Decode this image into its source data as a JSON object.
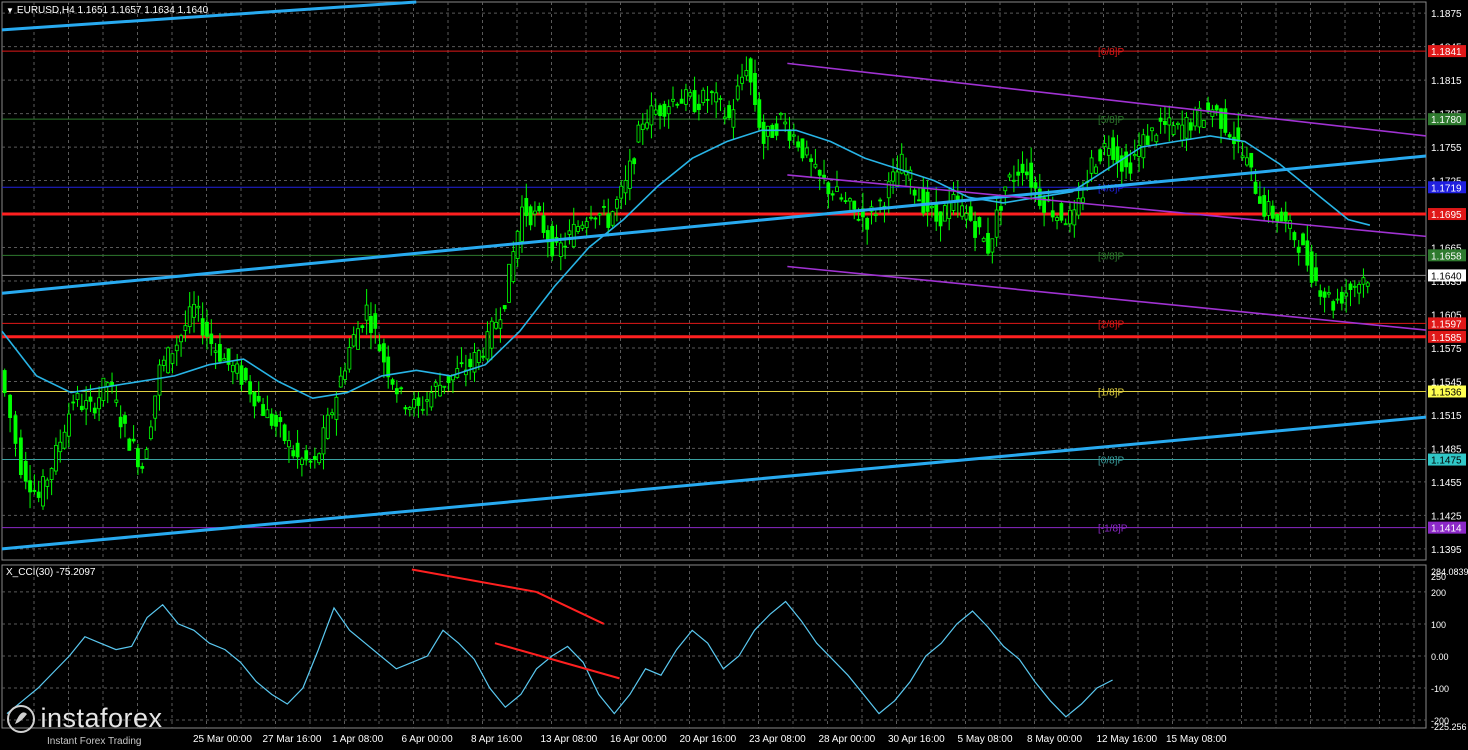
{
  "header": {
    "price_title": "EURUSD,H4  1.1651 1.1657 1.1634 1.1640",
    "cci_title": "X_CCI(30) -75.2097"
  },
  "brand": {
    "name": "instaforex",
    "tagline": "Instant Forex Trading"
  },
  "colors": {
    "background": "#000000",
    "grid": "#5a5a5a",
    "candle": "#00ff00",
    "ma": "#28b4e6",
    "trend": "#28aaf0",
    "channel": "#a032d2",
    "red_level": "#ff2020",
    "cci": "#5ac8f0"
  },
  "chart_data": [
    {
      "type": "candlestick",
      "symbol": "EURUSD",
      "timeframe": "H4",
      "ohlc_last": {
        "open": 1.1651,
        "high": 1.1657,
        "low": 1.1634,
        "close": 1.164
      },
      "ylim": [
        1.1385,
        1.1885
      ],
      "y_ticks": [
        "1.1875",
        "1.1845",
        "1.1815",
        "1.1785",
        "1.1755",
        "1.1725",
        "1.1695",
        "1.1665",
        "1.1635",
        "1.1605",
        "1.1575",
        "1.1545",
        "1.1515",
        "1.1485",
        "1.1455",
        "1.1425",
        "1.1395"
      ],
      "x_ticks": [
        "25 Mar 00:00",
        "27 Mar 16:00",
        "1 Apr 08:00",
        "6 Apr 00:00",
        "8 Apr 16:00",
        "13 Apr 08:00",
        "16 Apr 00:00",
        "20 Apr 16:00",
        "23 Apr 08:00",
        "28 Apr 00:00",
        "30 Apr 16:00",
        "5 May 08:00",
        "8 May 00:00",
        "12 May 16:00",
        "15 May 08:00"
      ],
      "close_path": [
        [
          0,
          1.1555
        ],
        [
          5,
          1.147
        ],
        [
          9,
          1.144
        ],
        [
          13,
          1.148
        ],
        [
          17,
          1.153
        ],
        [
          21,
          1.152
        ],
        [
          25,
          1.1545
        ],
        [
          29,
          1.15
        ],
        [
          33,
          1.147
        ],
        [
          37,
          1.1555
        ],
        [
          41,
          1.158
        ],
        [
          45,
          1.161
        ],
        [
          49,
          1.158
        ],
        [
          53,
          1.156
        ],
        [
          57,
          1.1545
        ],
        [
          61,
          1.152
        ],
        [
          65,
          1.15
        ],
        [
          69,
          1.1475
        ],
        [
          73,
          1.147
        ],
        [
          77,
          1.152
        ],
        [
          81,
          1.1575
        ],
        [
          85,
          1.161
        ],
        [
          89,
          1.1565
        ],
        [
          93,
          1.153
        ],
        [
          97,
          1.152
        ],
        [
          101,
          1.154
        ],
        [
          105,
          1.155
        ],
        [
          109,
          1.156
        ],
        [
          113,
          1.158
        ],
        [
          117,
          1.162
        ],
        [
          121,
          1.17
        ],
        [
          125,
          1.169
        ],
        [
          129,
          1.166
        ],
        [
          133,
          1.168
        ],
        [
          137,
          1.17
        ],
        [
          141,
          1.169
        ],
        [
          145,
          1.172
        ],
        [
          149,
          1.178
        ],
        [
          153,
          1.179
        ],
        [
          157,
          1.18
        ],
        [
          161,
          1.1795
        ],
        [
          165,
          1.18
        ],
        [
          169,
          1.178
        ],
        [
          173,
          1.183
        ],
        [
          177,
          1.176
        ],
        [
          181,
          1.178
        ],
        [
          185,
          1.176
        ],
        [
          189,
          1.173
        ],
        [
          193,
          1.1715
        ],
        [
          197,
          1.17
        ],
        [
          201,
          1.169
        ],
        [
          205,
          1.171
        ],
        [
          209,
          1.174
        ],
        [
          213,
          1.171
        ],
        [
          217,
          1.169
        ],
        [
          221,
          1.1705
        ],
        [
          225,
          1.169
        ],
        [
          229,
          1.1665
        ],
        [
          233,
          1.172
        ],
        [
          237,
          1.174
        ],
        [
          241,
          1.171
        ],
        [
          245,
          1.1695
        ],
        [
          249,
          1.169
        ],
        [
          253,
          1.174
        ],
        [
          257,
          1.176
        ],
        [
          261,
          1.1735
        ],
        [
          265,
          1.176
        ],
        [
          269,
          1.1775
        ],
        [
          273,
          1.177
        ],
        [
          277,
          1.178
        ],
        [
          281,
          1.179
        ],
        [
          285,
          1.177
        ],
        [
          289,
          1.174
        ],
        [
          293,
          1.17
        ],
        [
          297,
          1.169
        ],
        [
          301,
          1.167
        ],
        [
          305,
          1.1635
        ],
        [
          309,
          1.1615
        ],
        [
          313,
          1.163
        ],
        [
          317,
          1.164
        ]
      ],
      "ma_path": [
        [
          0,
          1.159
        ],
        [
          8,
          1.155
        ],
        [
          16,
          1.1535
        ],
        [
          24,
          1.154
        ],
        [
          32,
          1.1545
        ],
        [
          40,
          1.155
        ],
        [
          48,
          1.156
        ],
        [
          56,
          1.1565
        ],
        [
          64,
          1.1545
        ],
        [
          72,
          1.153
        ],
        [
          80,
          1.1535
        ],
        [
          88,
          1.155
        ],
        [
          96,
          1.1555
        ],
        [
          104,
          1.155
        ],
        [
          112,
          1.156
        ],
        [
          120,
          1.159
        ],
        [
          128,
          1.163
        ],
        [
          136,
          1.1665
        ],
        [
          144,
          1.169
        ],
        [
          152,
          1.172
        ],
        [
          160,
          1.1745
        ],
        [
          168,
          1.176
        ],
        [
          176,
          1.177
        ],
        [
          184,
          1.177
        ],
        [
          192,
          1.176
        ],
        [
          200,
          1.1745
        ],
        [
          208,
          1.1735
        ],
        [
          216,
          1.1725
        ],
        [
          224,
          1.171
        ],
        [
          232,
          1.1705
        ],
        [
          240,
          1.171
        ],
        [
          248,
          1.1715
        ],
        [
          256,
          1.1735
        ],
        [
          264,
          1.1755
        ],
        [
          272,
          1.176
        ],
        [
          280,
          1.1765
        ],
        [
          288,
          1.176
        ],
        [
          296,
          1.174
        ],
        [
          304,
          1.1715
        ],
        [
          312,
          1.169
        ],
        [
          317,
          1.1685
        ]
      ],
      "trend_lines": [
        {
          "from": [
            0,
            1.186
          ],
          "to": [
            96,
            1.1885
          ]
        },
        {
          "from": [
            0,
            1.1624
          ],
          "to": [
            330,
            1.1747
          ]
        },
        {
          "from": [
            0,
            1.1395
          ],
          "to": [
            330,
            1.1513
          ]
        }
      ],
      "channel_lines": [
        {
          "from": [
            182,
            1.183
          ],
          "to": [
            330,
            1.1765
          ]
        },
        {
          "from": [
            182,
            1.173
          ],
          "to": [
            330,
            1.1675
          ]
        },
        {
          "from": [
            182,
            1.1648
          ],
          "to": [
            330,
            1.1591
          ]
        }
      ],
      "levels": [
        {
          "price": 1.1841,
          "label": "[6/8]P",
          "value": "1.1841",
          "color": "#e01818",
          "bg": "#e01818",
          "style": "solid",
          "width": 1
        },
        {
          "price": 1.178,
          "label": "[5/8]P",
          "value": "1.1780",
          "color": "#2e7a2e",
          "bg": "#2e7a2e",
          "style": "solid",
          "width": 1
        },
        {
          "price": 1.1719,
          "label": "[4/8]P",
          "value": "1.1719",
          "color": "#2020e0",
          "bg": "#2020e0",
          "style": "solid",
          "width": 1
        },
        {
          "price": 1.1695,
          "label": "",
          "value": "1.1695",
          "color": "#ff2020",
          "bg": "#e01818",
          "style": "solid",
          "width": 3
        },
        {
          "price": 1.1658,
          "label": "[3/8]P",
          "value": "1.1658",
          "color": "#2e7a2e",
          "bg": "#2e7a2e",
          "style": "solid",
          "width": 1
        },
        {
          "price": 1.164,
          "label": "",
          "value": "1.1640",
          "color": "#8a8a8a",
          "bg": "#ffffff",
          "style": "solid",
          "width": 1
        },
        {
          "price": 1.1597,
          "label": "[2/8]P",
          "value": "1.1597",
          "color": "#e01818",
          "bg": "#e01818",
          "style": "solid",
          "width": 1
        },
        {
          "price": 1.1585,
          "label": "",
          "value": "1.1585",
          "color": "#ff2020",
          "bg": "#e01818",
          "style": "solid",
          "width": 3
        },
        {
          "price": 1.1536,
          "label": "[1/8]P",
          "value": "1.1536",
          "color": "#e0d040",
          "bg": "#ffff50",
          "style": "solid",
          "width": 1
        },
        {
          "price": 1.1475,
          "label": "[0/8]P",
          "value": "1.1475",
          "color": "#3aa0a0",
          "bg": "#30c8c8",
          "style": "solid",
          "width": 1
        },
        {
          "price": 1.1414,
          "label": "[-1/8]P",
          "value": "1.1414",
          "color": "#8c28c8",
          "bg": "#8c28c8",
          "style": "solid",
          "width": 1
        }
      ]
    },
    {
      "type": "line",
      "name": "X_CCI(30)",
      "value_last": -75.2097,
      "ylim": [
        -225,
        284.0839
      ],
      "y_ticks": [
        "284.0839",
        "250",
        "200",
        "100",
        "0.00",
        "-100",
        "-200",
        "-225.256"
      ],
      "series": [
        [
          0,
          -180
        ],
        [
          6,
          -140
        ],
        [
          12,
          -100
        ],
        [
          18,
          -50
        ],
        [
          24,
          0
        ],
        [
          30,
          60
        ],
        [
          36,
          40
        ],
        [
          42,
          20
        ],
        [
          48,
          30
        ],
        [
          54,
          120
        ],
        [
          60,
          160
        ],
        [
          66,
          100
        ],
        [
          72,
          80
        ],
        [
          78,
          40
        ],
        [
          84,
          20
        ],
        [
          90,
          -20
        ],
        [
          96,
          -80
        ],
        [
          102,
          -120
        ],
        [
          108,
          -150
        ],
        [
          114,
          -100
        ],
        [
          120,
          20
        ],
        [
          126,
          150
        ],
        [
          132,
          80
        ],
        [
          138,
          40
        ],
        [
          144,
          0
        ],
        [
          150,
          -40
        ],
        [
          156,
          -20
        ],
        [
          162,
          0
        ],
        [
          168,
          80
        ],
        [
          174,
          40
        ],
        [
          180,
          -10
        ],
        [
          186,
          -100
        ],
        [
          192,
          -160
        ],
        [
          198,
          -120
        ],
        [
          204,
          -40
        ],
        [
          210,
          0
        ],
        [
          216,
          30
        ],
        [
          222,
          -20
        ],
        [
          228,
          -120
        ],
        [
          234,
          -180
        ],
        [
          240,
          -120
        ],
        [
          246,
          -40
        ],
        [
          252,
          -60
        ],
        [
          258,
          20
        ],
        [
          264,
          80
        ],
        [
          270,
          40
        ],
        [
          276,
          -40
        ],
        [
          282,
          0
        ],
        [
          288,
          80
        ],
        [
          294,
          130
        ],
        [
          300,
          170
        ],
        [
          306,
          110
        ],
        [
          312,
          40
        ],
        [
          318,
          -10
        ],
        [
          324,
          -60
        ],
        [
          330,
          -120
        ],
        [
          336,
          -180
        ],
        [
          342,
          -140
        ],
        [
          348,
          -80
        ],
        [
          354,
          0
        ],
        [
          360,
          40
        ],
        [
          366,
          100
        ],
        [
          372,
          140
        ],
        [
          378,
          90
        ],
        [
          384,
          30
        ],
        [
          390,
          -10
        ],
        [
          396,
          -80
        ],
        [
          402,
          -140
        ],
        [
          408,
          -190
        ],
        [
          414,
          -150
        ],
        [
          420,
          -100
        ],
        [
          426,
          -75.2
        ]
      ],
      "divergence_lines": [
        {
          "from": [
            156,
            270
          ],
          "to": [
            204,
            200
          ]
        },
        {
          "from": [
            204,
            200
          ],
          "to": [
            230,
            100
          ]
        },
        {
          "from": [
            188,
            40
          ],
          "to": [
            236,
            -70
          ]
        }
      ]
    }
  ]
}
